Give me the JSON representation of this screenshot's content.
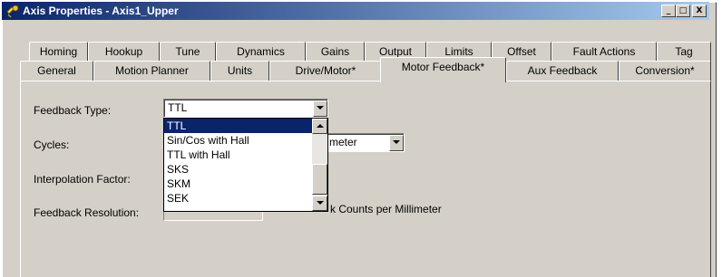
{
  "window": {
    "title": "Axis Properties - Axis1_Upper",
    "buttons": {
      "minimize": "_",
      "maximize": "□",
      "close": "X"
    }
  },
  "tabs_row1": [
    "Homing",
    "Hookup",
    "Tune",
    "Dynamics",
    "Gains",
    "Output",
    "Limits",
    "Offset",
    "Fault Actions",
    "Tag"
  ],
  "tabs_row2": [
    "General",
    "Motion Planner",
    "Units",
    "Drive/Motor*",
    "Motor Feedback*",
    "Aux Feedback",
    "Conversion*"
  ],
  "active_tab": "Motor Feedback*",
  "form": {
    "feedback_type_label": "Feedback Type:",
    "feedback_type_value": "TTL",
    "cycles_label": "Cycles:",
    "cycles_units": "meter",
    "interpolation_label": "Interpolation Factor:",
    "resolution_label": "Feedback Resolution:",
    "resolution_units": "k Counts per Millimeter"
  },
  "dropdown": {
    "options": [
      "TTL",
      "Sin/Cos with Hall",
      "TTL with Hall",
      "SKS",
      "SKM",
      "SEK"
    ],
    "selected": "TTL"
  }
}
